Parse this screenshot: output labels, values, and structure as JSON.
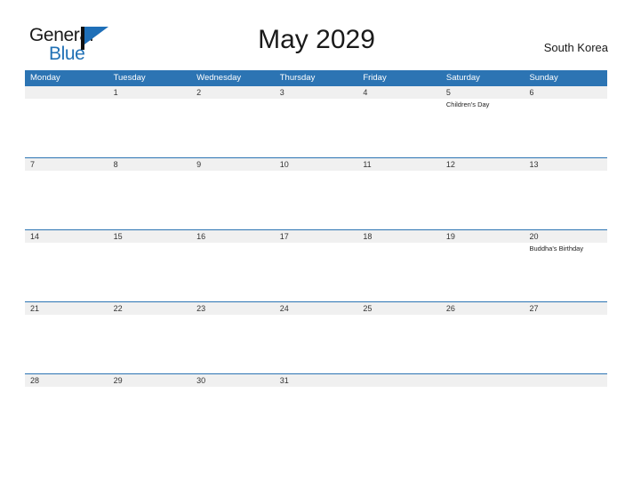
{
  "brand": {
    "name_part1": "General",
    "name_part2": "Blue",
    "mark_icon": "triangle-flag-icon",
    "accent_color": "#2171b5"
  },
  "header": {
    "title": "May 2029",
    "region": "South Korea"
  },
  "theme": {
    "header_blue": "#2c74b3",
    "date_band_gray": "#f0f0f0",
    "text_dark": "#1a1a1a"
  },
  "calendar": {
    "month": "May",
    "year": "2029",
    "day_headers": [
      "Monday",
      "Tuesday",
      "Wednesday",
      "Thursday",
      "Friday",
      "Saturday",
      "Sunday"
    ],
    "weeks": [
      {
        "days": [
          {
            "date": "",
            "event": ""
          },
          {
            "date": "1",
            "event": ""
          },
          {
            "date": "2",
            "event": ""
          },
          {
            "date": "3",
            "event": ""
          },
          {
            "date": "4",
            "event": ""
          },
          {
            "date": "5",
            "event": "Children's Day"
          },
          {
            "date": "6",
            "event": ""
          }
        ]
      },
      {
        "days": [
          {
            "date": "7",
            "event": ""
          },
          {
            "date": "8",
            "event": ""
          },
          {
            "date": "9",
            "event": ""
          },
          {
            "date": "10",
            "event": ""
          },
          {
            "date": "11",
            "event": ""
          },
          {
            "date": "12",
            "event": ""
          },
          {
            "date": "13",
            "event": ""
          }
        ]
      },
      {
        "days": [
          {
            "date": "14",
            "event": ""
          },
          {
            "date": "15",
            "event": ""
          },
          {
            "date": "16",
            "event": ""
          },
          {
            "date": "17",
            "event": ""
          },
          {
            "date": "18",
            "event": ""
          },
          {
            "date": "19",
            "event": ""
          },
          {
            "date": "20",
            "event": "Buddha's Birthday"
          }
        ]
      },
      {
        "days": [
          {
            "date": "21",
            "event": ""
          },
          {
            "date": "22",
            "event": ""
          },
          {
            "date": "23",
            "event": ""
          },
          {
            "date": "24",
            "event": ""
          },
          {
            "date": "25",
            "event": ""
          },
          {
            "date": "26",
            "event": ""
          },
          {
            "date": "27",
            "event": ""
          }
        ]
      },
      {
        "days": [
          {
            "date": "28",
            "event": ""
          },
          {
            "date": "29",
            "event": ""
          },
          {
            "date": "30",
            "event": ""
          },
          {
            "date": "31",
            "event": ""
          },
          {
            "date": "",
            "event": ""
          },
          {
            "date": "",
            "event": ""
          },
          {
            "date": "",
            "event": ""
          }
        ]
      }
    ]
  }
}
